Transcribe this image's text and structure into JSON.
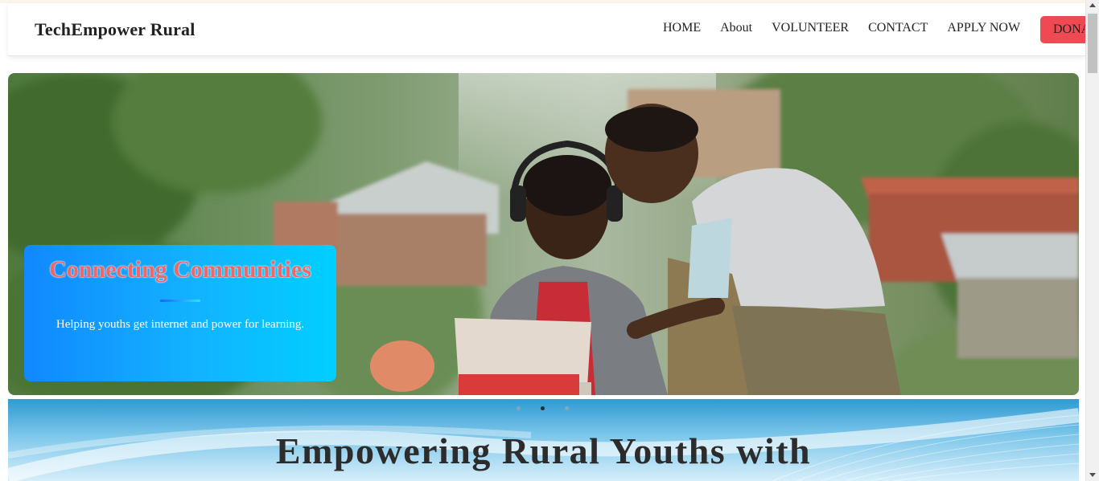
{
  "header": {
    "brand": "TechEmpower Rural",
    "nav": [
      {
        "label": "HOME"
      },
      {
        "label": "About"
      },
      {
        "label": "VOLUNTEER"
      },
      {
        "label": "CONTACT"
      },
      {
        "label": "APPLY NOW"
      }
    ],
    "donate_label": "DONATE"
  },
  "hero": {
    "caption_title": "Connecting Communities",
    "caption_text": "Helping youths get internet and power for learning.",
    "carousel_dots": 3,
    "active_dot": 2
  },
  "section": {
    "heading": "Empowering Rural Youths with"
  },
  "colors": {
    "accent_red": "#ef4a53",
    "caption_blue": "#12b3ff",
    "caption_title": "#f06767"
  }
}
